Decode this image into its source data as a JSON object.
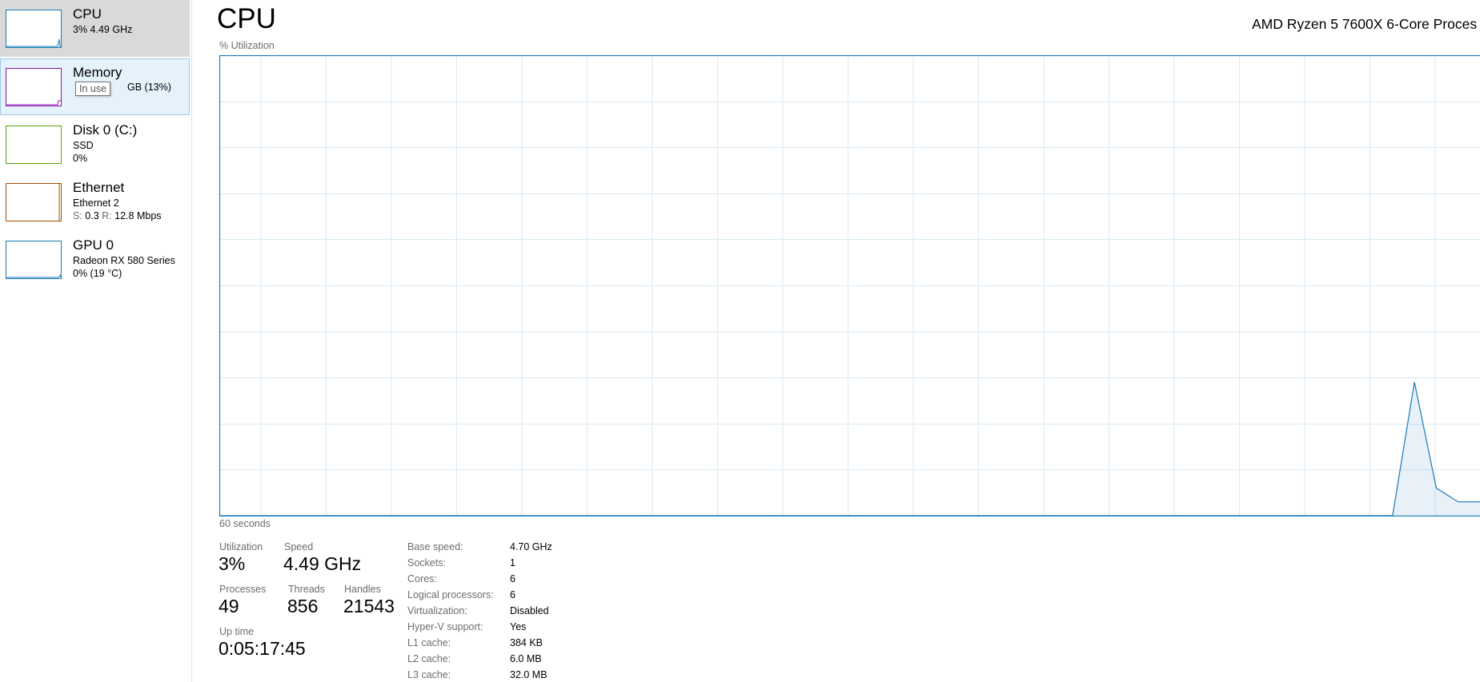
{
  "sidebar": {
    "items": [
      {
        "title": "CPU",
        "line1": "3%  4.49 GHz",
        "color": "#1a7ab8"
      },
      {
        "title": "Memory",
        "line1_visible": "GB (13%)",
        "color": "#8b12ae"
      },
      {
        "title": "Disk 0 (C:)",
        "line1": "SSD",
        "line2": "0%",
        "color": "#4da60c"
      },
      {
        "title": "Ethernet",
        "line1": "Ethernet 2",
        "send_label": "S:",
        "send_value": "0.3",
        "recv_label": "R:",
        "recv_value": "12.8 Mbps",
        "color": "#a74f01"
      },
      {
        "title": "GPU 0",
        "line1": "Radeon RX 580 Series",
        "line2": "0%  (19 °C)",
        "color": "#1a7ab8"
      }
    ],
    "tooltip": "In use"
  },
  "main": {
    "title": "CPU",
    "processor": "AMD Ryzen 5 7600X 6-Core Proces",
    "graph_label": "% Utilization",
    "time_label": "60 seconds",
    "graph_color": "#1a7ab8",
    "grid_color": "#d9eaf4"
  },
  "chart_data": {
    "type": "area",
    "x_label": "60 seconds",
    "y_label": "% Utilization",
    "ylim": [
      0,
      100
    ],
    "x": [
      0,
      1,
      2,
      3,
      4,
      5,
      6,
      7,
      8,
      9,
      10,
      11,
      12,
      13,
      14,
      15,
      16,
      17,
      18,
      19,
      20,
      21,
      22,
      23,
      24,
      25,
      26,
      27,
      28,
      29,
      30,
      31,
      32,
      33,
      34,
      35,
      36,
      37,
      38,
      39,
      40,
      41,
      42,
      43,
      44,
      45,
      46,
      47,
      48,
      49,
      50,
      51,
      52,
      53,
      54,
      55,
      56,
      57,
      58,
      59
    ],
    "values": [
      0,
      0,
      0,
      0,
      0,
      0,
      0,
      0,
      0,
      0,
      0,
      0,
      0,
      0,
      0,
      0,
      0,
      0,
      0,
      0,
      0,
      0,
      0,
      0,
      0,
      0,
      0,
      0,
      0,
      0,
      0,
      0,
      0,
      0,
      0,
      0,
      0,
      0,
      0,
      0,
      0,
      0,
      0,
      0,
      0,
      0,
      0,
      0,
      0,
      0,
      0,
      0,
      0,
      0,
      0,
      0,
      29,
      6,
      3,
      3
    ],
    "grid": true
  },
  "stats": {
    "utilization": {
      "label": "Utilization",
      "value": "3%"
    },
    "speed": {
      "label": "Speed",
      "value": "4.49 GHz"
    },
    "processes": {
      "label": "Processes",
      "value": "49"
    },
    "threads": {
      "label": "Threads",
      "value": "856"
    },
    "handles": {
      "label": "Handles",
      "value": "21543"
    },
    "uptime": {
      "label": "Up time",
      "value": "0:05:17:45"
    }
  },
  "specs": [
    {
      "label": "Base speed:",
      "value": "4.70 GHz"
    },
    {
      "label": "Sockets:",
      "value": "1"
    },
    {
      "label": "Cores:",
      "value": "6"
    },
    {
      "label": "Logical processors:",
      "value": "6"
    },
    {
      "label": "Virtualization:",
      "value": "Disabled"
    },
    {
      "label": "Hyper-V support:",
      "value": "Yes"
    },
    {
      "label": "L1 cache:",
      "value": "384 KB"
    },
    {
      "label": "L2 cache:",
      "value": "6.0 MB"
    },
    {
      "label": "L3 cache:",
      "value": "32.0 MB"
    }
  ]
}
